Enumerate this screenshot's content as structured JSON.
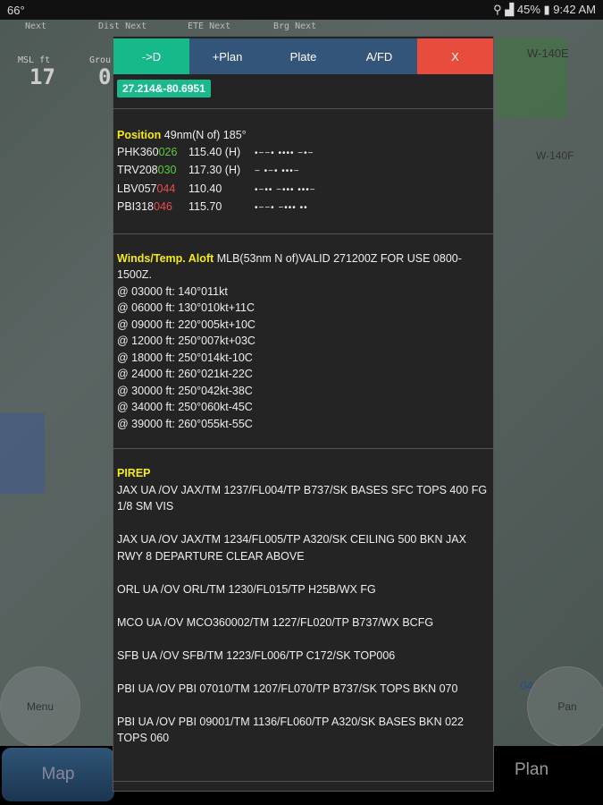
{
  "status_bar": {
    "left": "66°",
    "battery": "45%",
    "time": "9:42 AM"
  },
  "map_info": {
    "labels": [
      "Next",
      "Dist Next",
      "ETE Next",
      "Brg Next"
    ],
    "msl_label": "MSL ft",
    "msl_value": "17",
    "ground_label": "Grou",
    "ground_value": "0",
    "airspace_1": "W-140E",
    "airspace_2": "W-140F",
    "runway": "04"
  },
  "map_controls": {
    "menu": "Menu",
    "pan": "Pan"
  },
  "bottom_nav": {
    "map": "Map",
    "plan": "Plan"
  },
  "dialog": {
    "buttons": [
      {
        "label": "->D",
        "color": "#16b98a"
      },
      {
        "label": "+Plan",
        "color": "#33557a"
      },
      {
        "label": "Plate",
        "color": "#33557a"
      },
      {
        "label": "A/FD",
        "color": "#33557a"
      },
      {
        "label": "X",
        "color": "#e74c3c"
      }
    ],
    "coordinates": "27.214&-80.6951",
    "position": {
      "title": "Position",
      "text": "49nm(N of) 185°",
      "vors": [
        {
          "id": "PHK360",
          "dist": "026",
          "dist_color": "green",
          "freq": "115.40 (H)",
          "morse": "•−−• •••• −•−"
        },
        {
          "id": "TRV208",
          "dist": "030",
          "dist_color": "green",
          "freq": "117.30 (H)",
          "morse": "− •−• •••−"
        },
        {
          "id": "LBV057",
          "dist": "044",
          "dist_color": "red",
          "freq": "110.40",
          "morse": "•−•• −••• •••−"
        },
        {
          "id": "PBI318",
          "dist": "046",
          "dist_color": "red",
          "freq": "115.70",
          "morse": "•−−• −••• ••"
        }
      ]
    },
    "winds": {
      "title": "Winds/Temp. Aloft",
      "header": "MLB(53nm N of)VALID 271200Z FOR USE 0800-1500Z.",
      "rows": [
        "@ 03000 ft: 140°011kt",
        "@ 06000 ft: 130°010kt+11C",
        "@ 09000 ft: 220°005kt+10C",
        "@ 12000 ft: 250°007kt+03C",
        "@ 18000 ft: 250°014kt-10C",
        "@ 24000 ft: 260°021kt-22C",
        "@ 30000 ft: 250°042kt-38C",
        "@ 34000 ft: 250°060kt-45C",
        "@ 39000 ft: 260°055kt-55C"
      ]
    },
    "pirep": {
      "title": "PIREP",
      "reports": [
        "JAX UA /OV JAX/TM 1237/FL004/TP B737/SK BASES SFC TOPS 400 FG 1/8 SM VIS",
        "JAX UA /OV JAX/TM 1234/FL005/TP A320/SK CEILING 500 BKN JAX RWY 8 DEPARTURE CLEAR ABOVE",
        "ORL UA /OV ORL/TM 1230/FL015/TP H25B/WX FG",
        "MCO UA /OV MCO360002/TM 1227/FL020/TP B737/WX BCFG",
        "SFB UA /OV SFB/TM 1223/FL006/TP C172/SK TOP006",
        "PBI UA /OV PBI 07010/TM 1207/FL070/TP B737/SK TOPS BKN 070",
        "PBI UA /OV PBI 09001/TM 1136/FL060/TP A320/SK BASES BKN 022 TOPS 060"
      ]
    }
  }
}
